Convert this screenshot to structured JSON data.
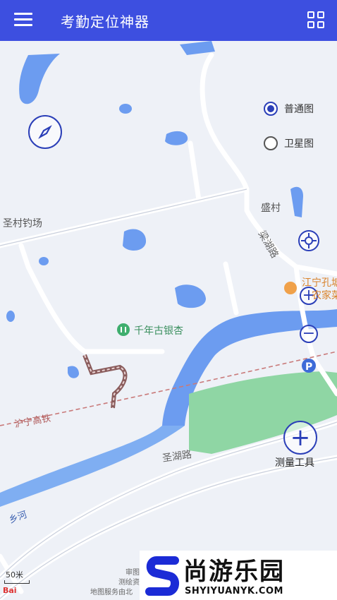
{
  "app": {
    "title": "考勤定位神器"
  },
  "map_layers": {
    "normal": "普通图",
    "satellite": "卫星图",
    "selected": "normal"
  },
  "places": {
    "fishing": "圣村钓场",
    "ginkgo": "千年古银杏",
    "shengcun": "盛村",
    "poi": "江宁孔塘",
    "poi2": "农家菜",
    "road1": "圣湖路",
    "road2": "梁湖路",
    "railway": "沪宁高铁",
    "river": "乡河"
  },
  "tools": {
    "measure": "测量工具"
  },
  "scale": "50米",
  "copyright": {
    "line1": "审图",
    "line2": "测绘资",
    "line3": "地图服务由北"
  },
  "logo": "Bai",
  "watermark": {
    "cn": "尚游乐园",
    "en": "SHYIYUANYK.COM"
  },
  "colors": {
    "accent": "#3d4fe0",
    "control": "#2b3fb8",
    "water": "#6c9cf0",
    "green": "#8fd6a4"
  }
}
